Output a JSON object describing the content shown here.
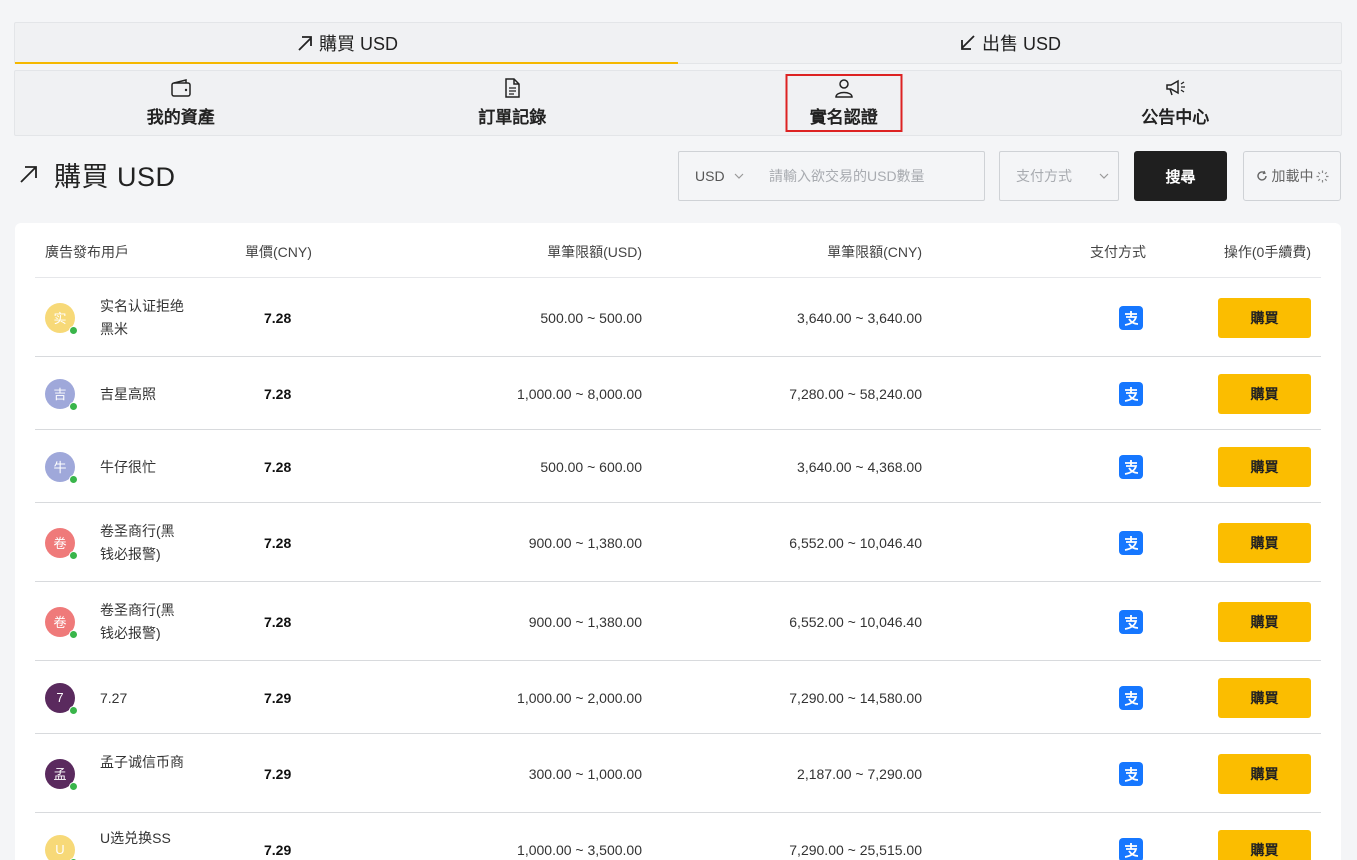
{
  "trade_tabs": [
    {
      "label": "購買 USD",
      "active": true
    },
    {
      "label": "出售 USD",
      "active": false
    }
  ],
  "subnav": [
    {
      "label": "我的資產",
      "icon": "wallet-icon"
    },
    {
      "label": "訂單記錄",
      "icon": "document-icon"
    },
    {
      "label": "實名認證",
      "icon": "user-icon",
      "highlighted": true
    },
    {
      "label": "公告中心",
      "icon": "megaphone-icon"
    }
  ],
  "page": {
    "title": "購買 USD"
  },
  "search": {
    "currency": "USD",
    "placeholder": "請輸入欲交易的USD數量",
    "pay_placeholder": "支付方式",
    "search_label": "搜尋",
    "loading_label": "加載中"
  },
  "table": {
    "headers": {
      "user": "廣告發布用戶",
      "price": "單價(CNY)",
      "limit_usd": "單筆限額(USD)",
      "limit_cny": "單筆限額(CNY)",
      "pay": "支付方式",
      "op": "操作(0手續費)"
    },
    "buy_label": "購買",
    "rows": [
      {
        "avatar": "实",
        "avatar_color": "#f7d978",
        "name": "实名认证拒绝黑米",
        "price": "7.28",
        "usd": "500.00 ~ 500.00",
        "cny": "3,640.00 ~ 3,640.00"
      },
      {
        "avatar": "吉",
        "avatar_color": "#9fa8da",
        "name": "吉星高照",
        "price": "7.28",
        "usd": "1,000.00 ~ 8,000.00",
        "cny": "7,280.00 ~ 58,240.00"
      },
      {
        "avatar": "牛",
        "avatar_color": "#9fa8da",
        "name": "牛仔很忙",
        "price": "7.28",
        "usd": "500.00 ~ 600.00",
        "cny": "3,640.00 ~ 4,368.00"
      },
      {
        "avatar": "卷",
        "avatar_color": "#ef7a7a",
        "name": "卷圣商行(黑钱必报警)",
        "price": "7.28",
        "usd": "900.00 ~ 1,380.00",
        "cny": "6,552.00 ~ 10,046.40"
      },
      {
        "avatar": "卷",
        "avatar_color": "#ef7a7a",
        "name": "卷圣商行(黑钱必报警)",
        "price": "7.28",
        "usd": "900.00 ~ 1,380.00",
        "cny": "6,552.00 ~ 10,046.40"
      },
      {
        "avatar": "7",
        "avatar_color": "#5a2a5e",
        "name": "7.27",
        "price": "7.29",
        "usd": "1,000.00 ~ 2,000.00",
        "cny": "7,290.00 ~ 14,580.00"
      },
      {
        "avatar": "孟",
        "avatar_color": "#5a2a5e",
        "name": "孟子诚信币商",
        "price": "7.29",
        "usd": "300.00 ~ 1,000.00",
        "cny": "2,187.00 ~ 7,290.00"
      },
      {
        "avatar": "U",
        "avatar_color": "#f7d978",
        "name": "U选兑换SS",
        "price": "7.29",
        "usd": "1,000.00 ~ 3,500.00",
        "cny": "7,290.00 ~ 25,515.00"
      }
    ]
  }
}
